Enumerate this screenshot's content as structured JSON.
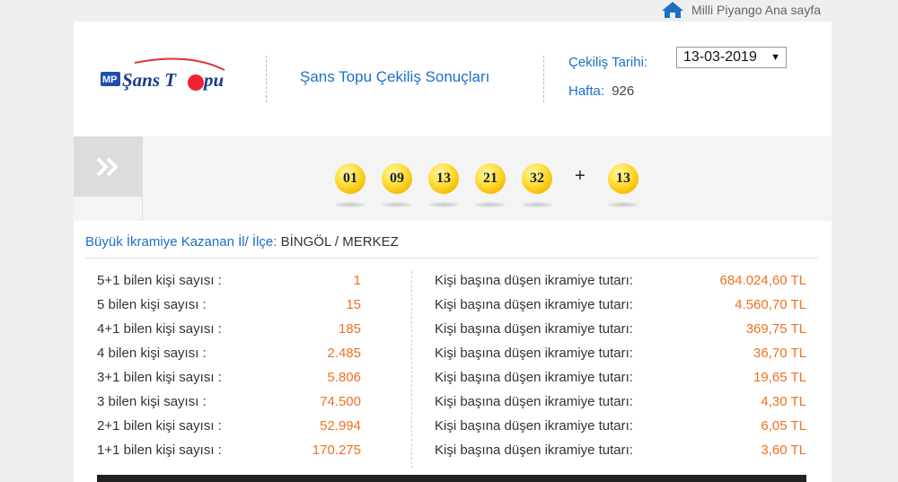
{
  "nav": {
    "home_label": "Milli Piyango Ana sayfa"
  },
  "header": {
    "logo_text": "Şans Topu",
    "title": "Şans Topu Çekiliş Sonuçları",
    "date_label": "Çekiliş Tarihi:",
    "date_value": "13-03-2019",
    "week_label": "Hafta:",
    "week_value": "926"
  },
  "draw": {
    "balls": [
      "01",
      "09",
      "13",
      "21",
      "32"
    ],
    "plus": "+",
    "bonus": "13"
  },
  "winner": {
    "label": "Büyük İkramiye Kazanan İl/ İlçe:",
    "value": "BİNGÖL / MERKEZ"
  },
  "results": [
    {
      "label": "5+1 bilen kişi sayısı :",
      "count": "1",
      "prize_label": "Kişi başına düşen ikramiye tutarı:",
      "prize": "684.024,60 TL"
    },
    {
      "label": "5 bilen kişi sayısı :",
      "count": "15",
      "prize_label": "Kişi başına düşen ikramiye tutarı:",
      "prize": "4.560,70 TL"
    },
    {
      "label": "4+1 bilen kişi sayısı :",
      "count": "185",
      "prize_label": "Kişi başına düşen ikramiye tutarı:",
      "prize": "369,75 TL"
    },
    {
      "label": "4 bilen kişi sayısı :",
      "count": "2.485",
      "prize_label": "Kişi başına düşen ikramiye tutarı:",
      "prize": "36,70 TL"
    },
    {
      "label": "3+1 bilen kişi sayısı :",
      "count": "5.806",
      "prize_label": "Kişi başına düşen ikramiye tutarı:",
      "prize": "19,65 TL"
    },
    {
      "label": "3 bilen kişi sayısı :",
      "count": "74.500",
      "prize_label": "Kişi başına düşen ikramiye tutarı:",
      "prize": "4,30 TL"
    },
    {
      "label": "2+1 bilen kişi sayısı :",
      "count": "52.994",
      "prize_label": "Kişi başına düşen ikramiye tutarı:",
      "prize": "6,05 TL"
    },
    {
      "label": "1+1 bilen kişi sayısı :",
      "count": "170.275",
      "prize_label": "Kişi başına düşen ikramiye tutarı:",
      "prize": "3,60 TL"
    }
  ],
  "colors": {
    "accent": "#1e6ec8",
    "value": "#f07020",
    "ball": "#ffd21f"
  }
}
